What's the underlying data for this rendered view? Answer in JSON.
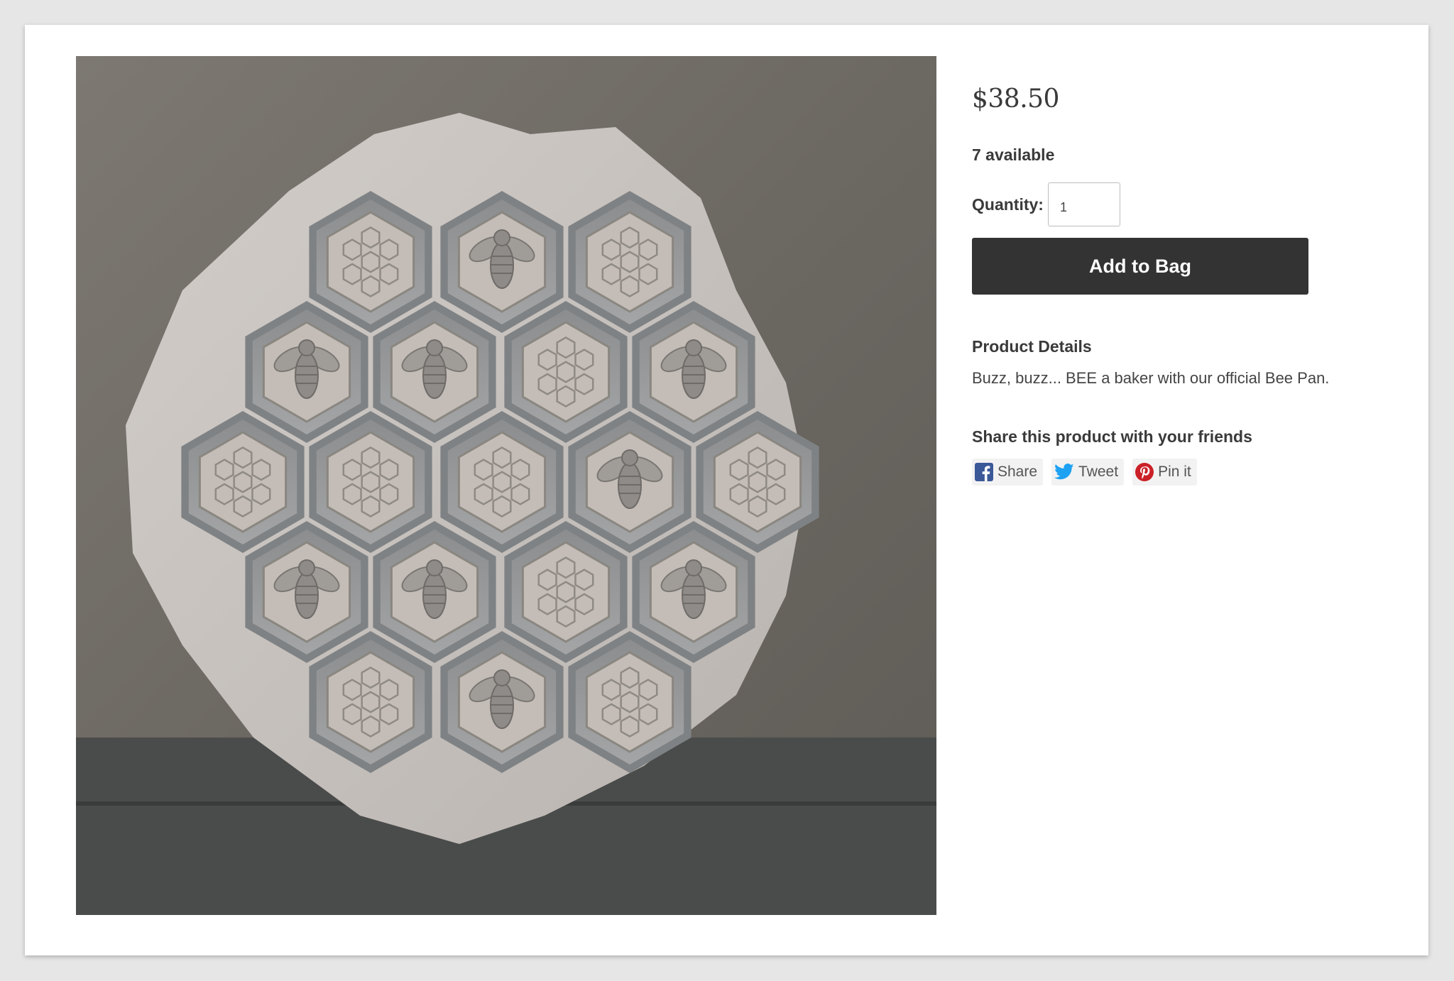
{
  "product": {
    "image_alt": "Bee pan",
    "price": "$38.50",
    "availability": "7 available",
    "quantity": {
      "label": "Quantity:",
      "value": "1"
    },
    "add_button": "Add to Bag",
    "details": {
      "heading": "Product Details",
      "text": "Buzz, buzz... BEE a baker with our official Bee Pan."
    }
  },
  "share": {
    "heading": "Share this product with your friends",
    "buttons": [
      {
        "label": "Share",
        "icon": "facebook-icon",
        "color": "#3b5998"
      },
      {
        "label": "Tweet",
        "icon": "twitter-icon",
        "color": "#1da1f2"
      },
      {
        "label": "Pin it",
        "icon": "pinterest-icon",
        "color": "#cb2027"
      }
    ]
  },
  "colors": {
    "button_bg": "#333333",
    "page_bg": "#e6e6e6",
    "card_bg": "#ffffff"
  }
}
